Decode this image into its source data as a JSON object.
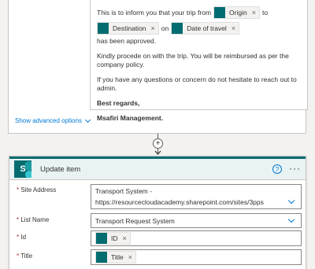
{
  "email": {
    "line1_prefix": "This is to inform you that your trip from",
    "origin_token": "Origin",
    "to_word": "to",
    "destination_token": "Destination",
    "on_word": "on",
    "date_token": "Date of travel",
    "approved_suffix": "has been approved.",
    "paragraph2": "Kindly procede on with the trip. You will be reimbursed as per the company policy.",
    "paragraph3": "If you have any questions or concern do not hesitate to reach out to admin.",
    "closing": "Best regards,",
    "signature": "Msafiri Management.",
    "remove_symbol": "×"
  },
  "advanced_options": "Show advanced options",
  "connector": {
    "plus": "+"
  },
  "action": {
    "title": "Update item",
    "help_symbol": "?",
    "more_symbol": "···",
    "logo_letter": "S",
    "fields": {
      "site_address": {
        "label": "Site Address",
        "line1": "Transport System -",
        "line2": "https://resourcecloudacademy.sharepoint.com/sites/3pps"
      },
      "list_name": {
        "label": "List Name",
        "value": "Transport Request System"
      },
      "id": {
        "label": "Id",
        "token": "ID"
      },
      "title": {
        "label": "Title",
        "token": "Title"
      }
    },
    "required_marker": "*"
  },
  "colors": {
    "sharepoint": "#036c70",
    "link": "#0078d4",
    "required": "#a4262c"
  }
}
